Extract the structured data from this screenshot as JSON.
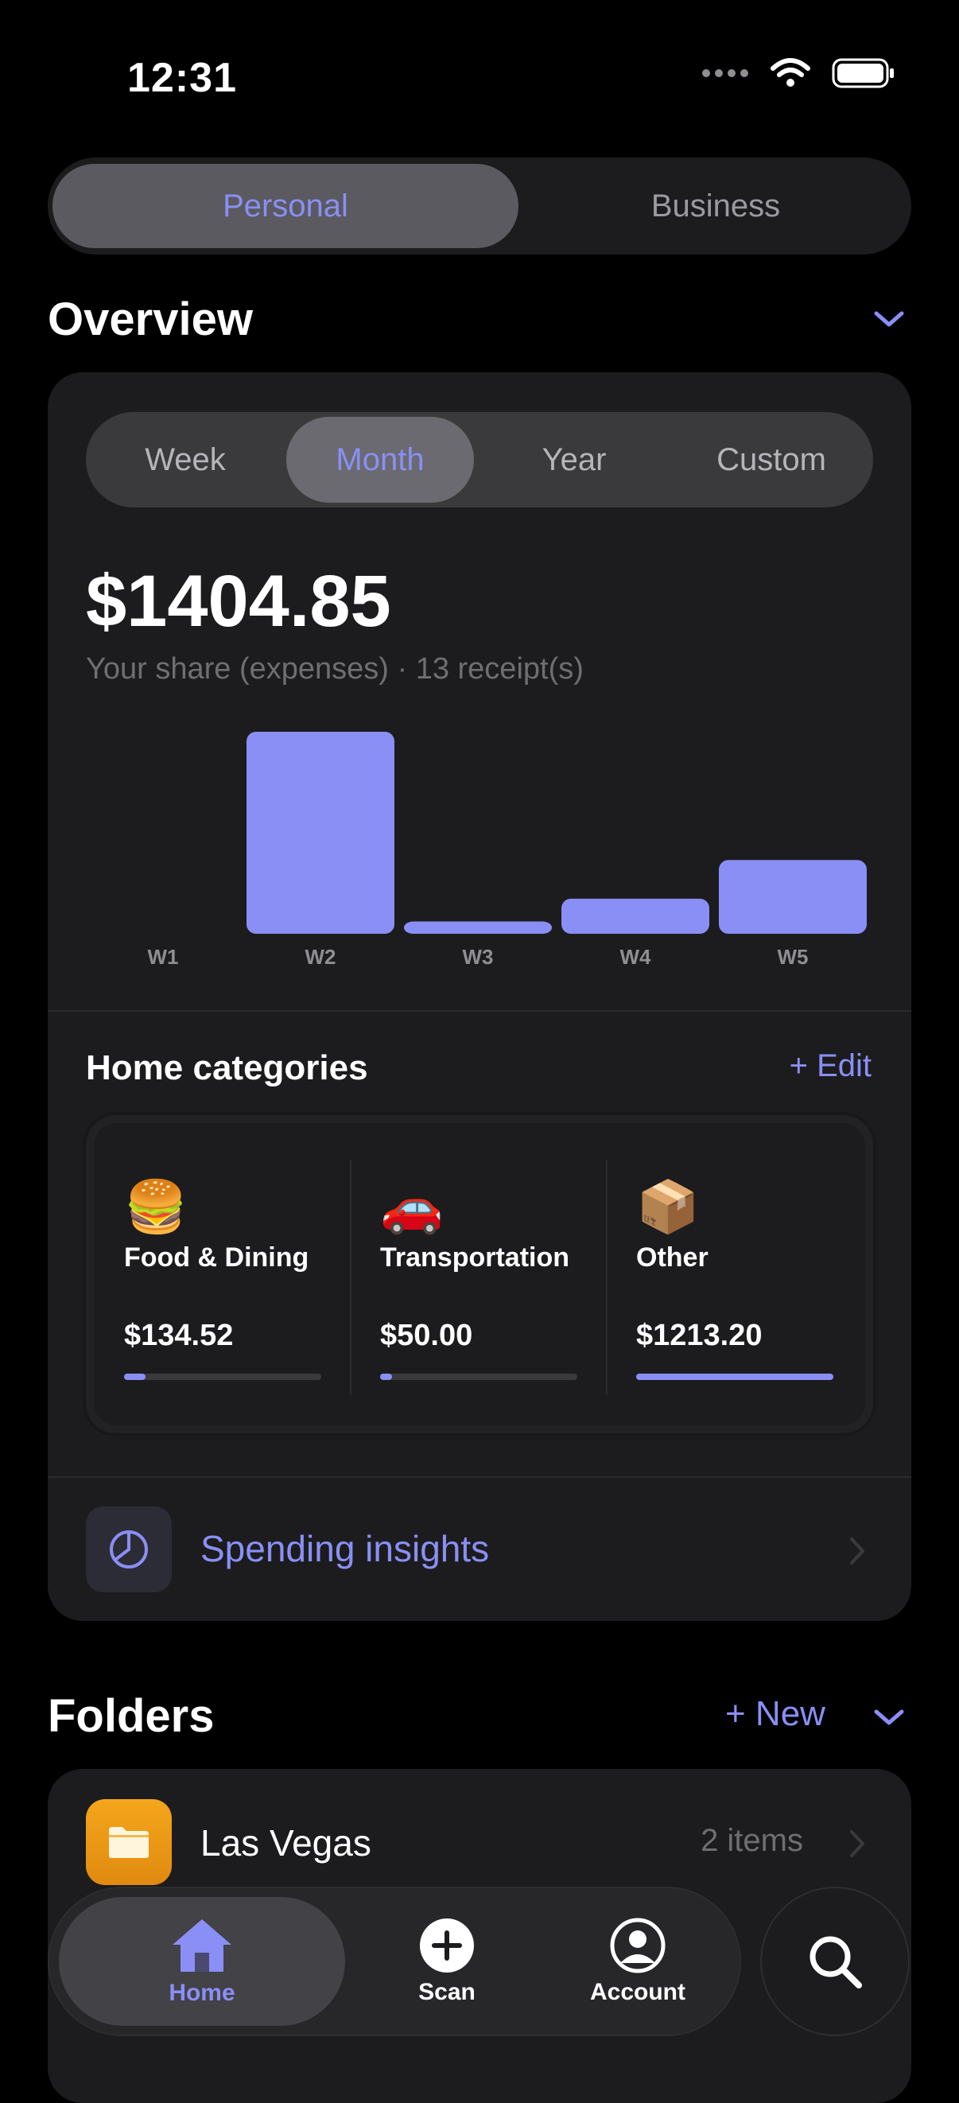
{
  "status_bar": {
    "time": "12:31"
  },
  "mode_toggle": {
    "options": [
      "Personal",
      "Business"
    ],
    "selected": "Personal"
  },
  "overview": {
    "title": "Overview",
    "periods": [
      "Week",
      "Month",
      "Year",
      "Custom"
    ],
    "selected_period": "Month",
    "amount": "$1404.85",
    "subtitle": "Your share (expenses) · 13 receipt(s)"
  },
  "chart_data": {
    "type": "bar",
    "categories": [
      "W1",
      "W2",
      "W3",
      "W4",
      "W5"
    ],
    "values": [
      0,
      1150,
      70,
      200,
      420
    ],
    "color": "#8a8ff5"
  },
  "categories": {
    "title": "Home categories",
    "edit_label": "+ Edit",
    "items": [
      {
        "emoji": "🍔",
        "name": "Food & Dining",
        "amount": "$134.52",
        "share": 0.11
      },
      {
        "emoji": "🚗",
        "name": "Transportation",
        "amount": "$50.00",
        "share": 0.06
      },
      {
        "emoji": "📦",
        "name": "Other",
        "amount": "$1213.20",
        "share": 1.0
      }
    ]
  },
  "insights": {
    "label": "Spending insights"
  },
  "folders": {
    "title": "Folders",
    "new_label": "+ New",
    "items": [
      {
        "name": "Las Vegas",
        "count": "2 items"
      }
    ]
  },
  "tabbar": {
    "tabs": [
      {
        "label": "Home",
        "icon": "house-icon"
      },
      {
        "label": "Scan",
        "icon": "plus-circle-icon"
      },
      {
        "label": "Account",
        "icon": "person-circle-icon"
      }
    ],
    "selected": "Home",
    "search_icon": "search-icon"
  },
  "colors": {
    "accent": "#8a8ff5",
    "background": "#000000",
    "card": "#1c1c1e",
    "folder": "#f4a61b"
  }
}
